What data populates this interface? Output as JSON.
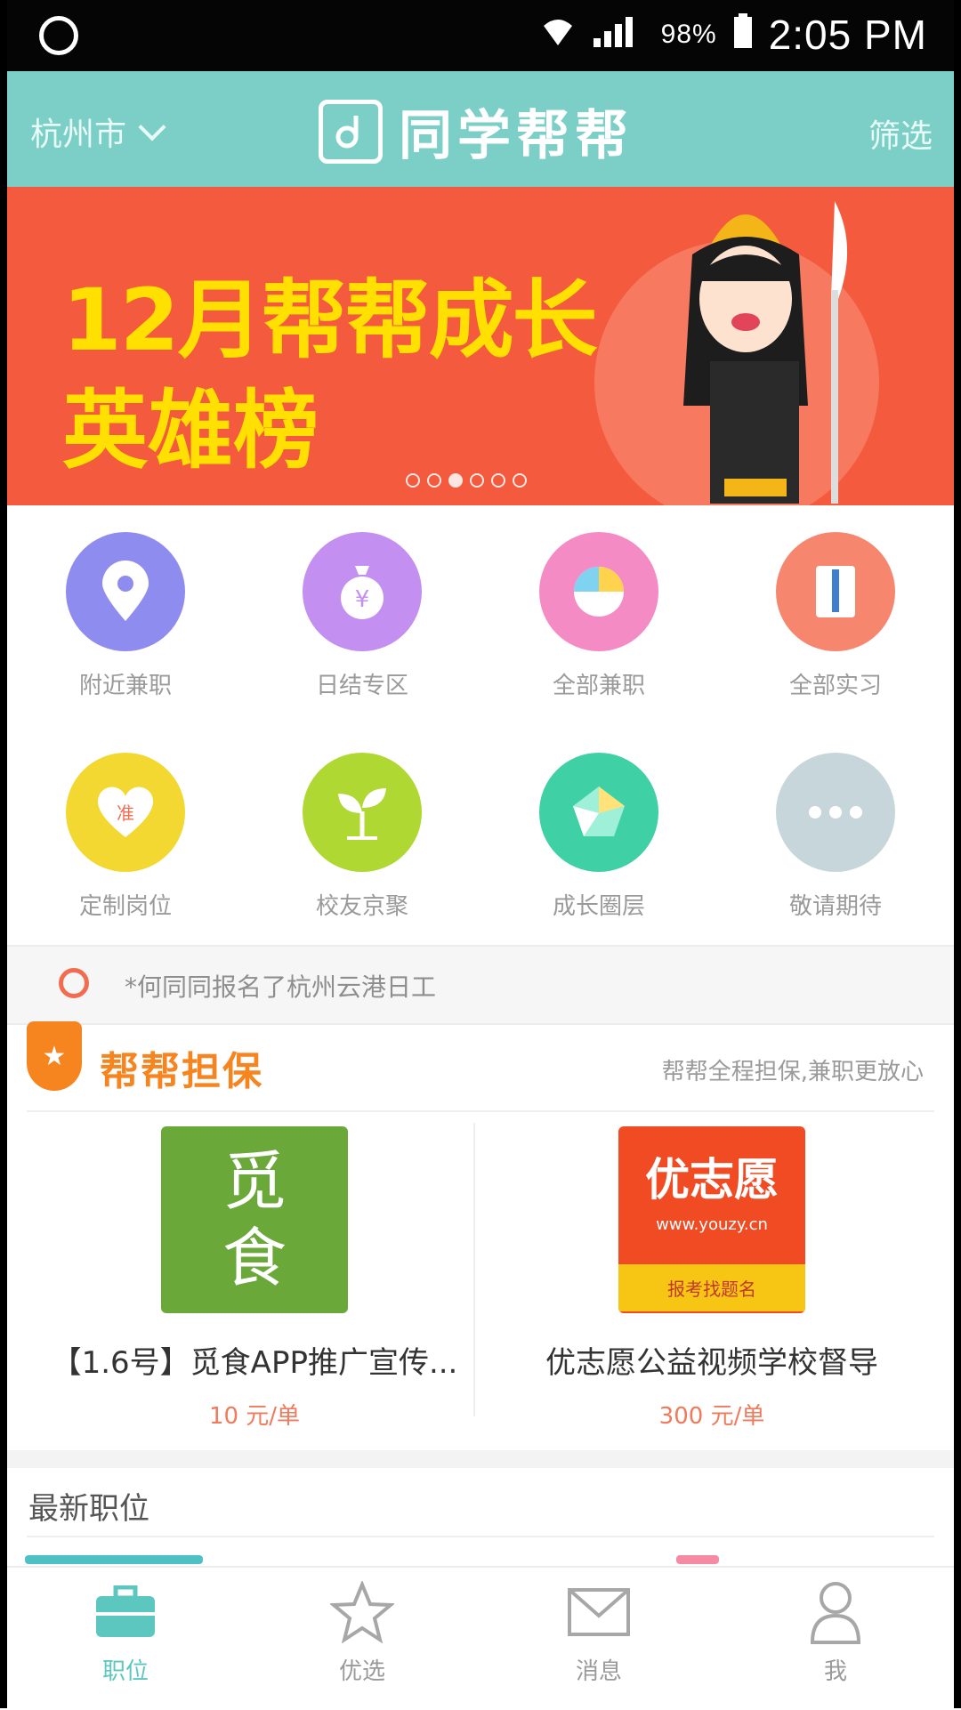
{
  "status_bar": {
    "battery": "98%",
    "time": "2:05 PM"
  },
  "header": {
    "city": "杭州市",
    "app_name": "同学帮帮",
    "filter_label": "筛选"
  },
  "banner": {
    "line1": "12月帮帮成长",
    "line2": "英雄榜",
    "active_dot": 3,
    "dot_count": 6
  },
  "categories": [
    {
      "label": "附近兼职",
      "icon": "location-pin-icon",
      "color": "#8f8cf0"
    },
    {
      "label": "日结专区",
      "icon": "money-bag-icon",
      "color": "#c38ff0"
    },
    {
      "label": "全部兼职",
      "icon": "pie-chart-icon",
      "color": "#f58bc5"
    },
    {
      "label": "全部实习",
      "icon": "briefcase-suit-icon",
      "color": "#f7866f"
    },
    {
      "label": "定制岗位",
      "icon": "heart-icon",
      "color": "#f2d830"
    },
    {
      "label": "校友京聚",
      "icon": "sprout-icon",
      "color": "#b0d832"
    },
    {
      "label": "成长圈层",
      "icon": "gem-icon",
      "color": "#3fd0a6"
    },
    {
      "label": "敬请期待",
      "icon": "more-dots-icon",
      "color": "#c7d6da"
    }
  ],
  "notice": {
    "text": "*何同同报名了杭州云港日工"
  },
  "guarantee_section": {
    "title": "帮帮担保",
    "subtitle": "帮帮全程担保,兼职更放心"
  },
  "featured_jobs": [
    {
      "logo_text": [
        "觅",
        "食"
      ],
      "logo_color": "#6aa83a",
      "title": "【1.6号】觅食APP推广宣传...",
      "price": "10 元/单"
    },
    {
      "logo_text": [
        "优志愿",
        "www.youzy.cn",
        "报考找题名"
      ],
      "logo_color": "#f04b23",
      "title": "优志愿公益视频学校督导",
      "price": "300 元/单"
    }
  ],
  "latest_section": {
    "title": "最新职位"
  },
  "tabs": [
    {
      "label": "职位",
      "icon": "briefcase-icon",
      "active": true
    },
    {
      "label": "优选",
      "icon": "star-icon",
      "active": false
    },
    {
      "label": "消息",
      "icon": "mail-icon",
      "active": false
    },
    {
      "label": "我",
      "icon": "person-icon",
      "active": false
    }
  ]
}
